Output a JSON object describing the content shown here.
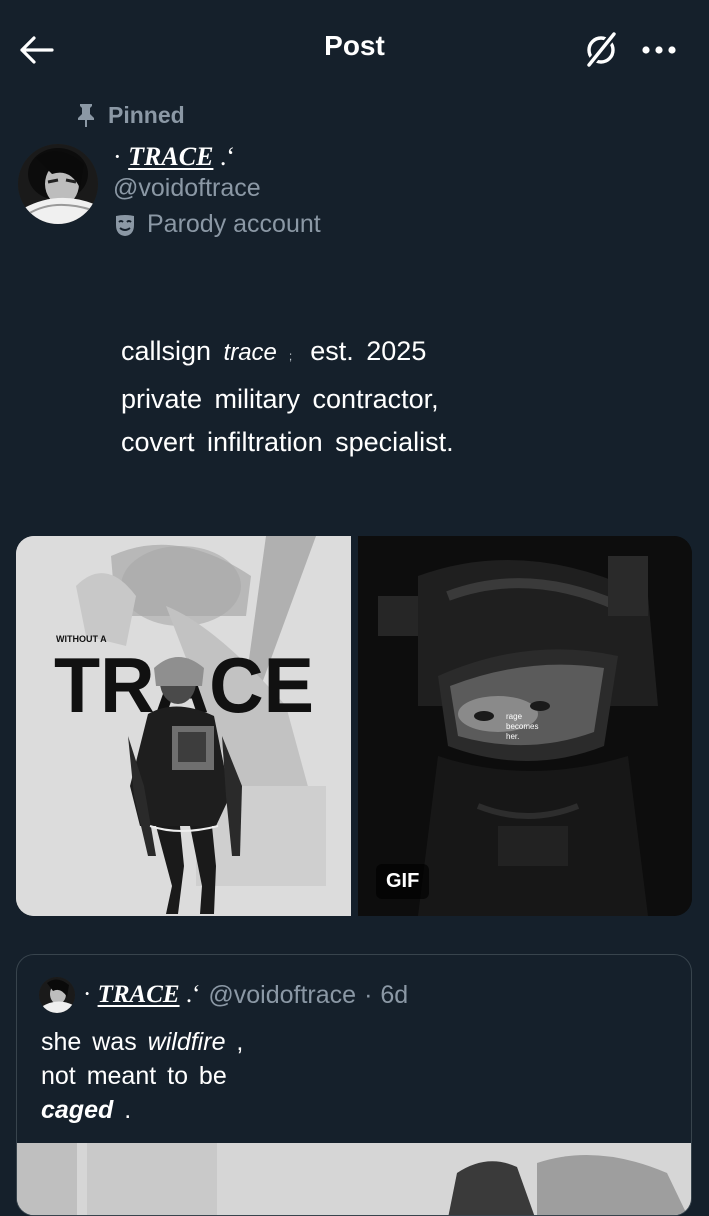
{
  "header": {
    "title": "Post"
  },
  "pinned": {
    "label": "Pinned"
  },
  "author": {
    "name_prefix": "· ",
    "name": "TRACE",
    "name_suffix": " .ʻ",
    "handle": "@voidoftrace",
    "parody_label": "Parody account"
  },
  "bio": {
    "line1_a": "callsign ",
    "line1_italic": "trace",
    "line1_sep": ";",
    "line1_b": "est. 2025",
    "line2": "private military contractor,",
    "line3": "covert infiltration specialist."
  },
  "media": {
    "left_small": "WITHOUT A",
    "left_big": "TRACE",
    "right_caption_1": "rage",
    "right_caption_2": "becomes",
    "right_caption_3": "her.",
    "gif_badge": "GIF"
  },
  "quote": {
    "name_prefix": "· ",
    "name": "TRACE",
    "name_suffix": " .ʻ",
    "handle": "@voidoftrace",
    "separator": "·",
    "time": "6d",
    "line1_a": "she was ",
    "line1_italic": "wildfire",
    "line1_b": " ,",
    "line2": "not meant to be",
    "line3_bold_italic": "caged",
    "line3_b": " ."
  },
  "colors": {
    "background": "#15202b",
    "text_primary": "#ffffff",
    "text_secondary": "#8b98a5",
    "border": "#38444d"
  },
  "icons": {
    "back": "arrow-left-icon",
    "grok": "grok-icon",
    "more": "more-horizontal-icon",
    "pin": "pin-icon",
    "parody": "theater-mask-icon"
  }
}
